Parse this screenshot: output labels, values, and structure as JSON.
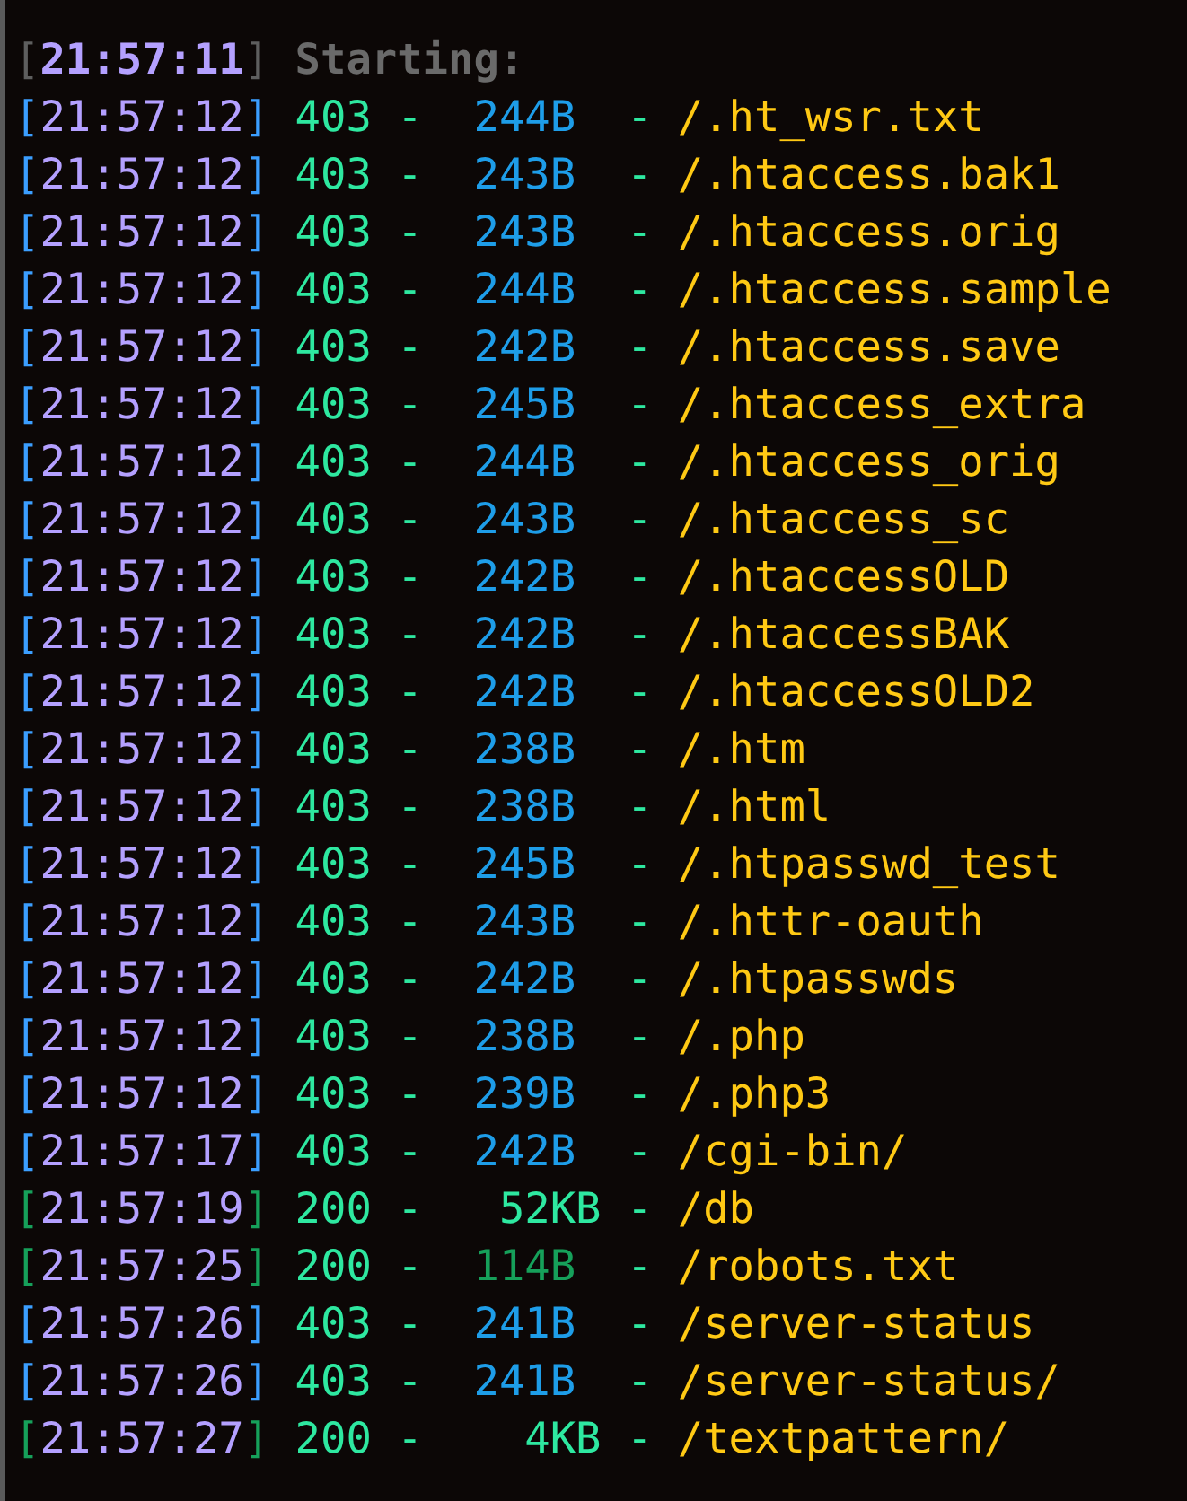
{
  "header": {
    "open": "[",
    "time": "21:57:11",
    "close": "]",
    "message": "Starting:"
  },
  "lines": [
    {
      "kind": "blocked",
      "open": "[",
      "time": "21:57:12",
      "close": "]",
      "status": "403",
      "dash": "-",
      "size": {
        "text": "244B",
        "kind": "bytes",
        "color": "#1e9de8"
      },
      "dash2": "-",
      "path": "/.ht_wsr.txt"
    },
    {
      "kind": "blocked",
      "open": "[",
      "time": "21:57:12",
      "close": "]",
      "status": "403",
      "dash": "-",
      "size": {
        "text": "243B",
        "kind": "bytes",
        "color": "#1e9de8"
      },
      "dash2": "-",
      "path": "/.htaccess.bak1"
    },
    {
      "kind": "blocked",
      "open": "[",
      "time": "21:57:12",
      "close": "]",
      "status": "403",
      "dash": "-",
      "size": {
        "text": "243B",
        "kind": "bytes",
        "color": "#1e9de8"
      },
      "dash2": "-",
      "path": "/.htaccess.orig"
    },
    {
      "kind": "blocked",
      "open": "[",
      "time": "21:57:12",
      "close": "]",
      "status": "403",
      "dash": "-",
      "size": {
        "text": "244B",
        "kind": "bytes",
        "color": "#1e9de8"
      },
      "dash2": "-",
      "path": "/.htaccess.sample"
    },
    {
      "kind": "blocked",
      "open": "[",
      "time": "21:57:12",
      "close": "]",
      "status": "403",
      "dash": "-",
      "size": {
        "text": "242B",
        "kind": "bytes",
        "color": "#1e9de8"
      },
      "dash2": "-",
      "path": "/.htaccess.save"
    },
    {
      "kind": "blocked",
      "open": "[",
      "time": "21:57:12",
      "close": "]",
      "status": "403",
      "dash": "-",
      "size": {
        "text": "245B",
        "kind": "bytes",
        "color": "#1e9de8"
      },
      "dash2": "-",
      "path": "/.htaccess_extra"
    },
    {
      "kind": "blocked",
      "open": "[",
      "time": "21:57:12",
      "close": "]",
      "status": "403",
      "dash": "-",
      "size": {
        "text": "244B",
        "kind": "bytes",
        "color": "#1e9de8"
      },
      "dash2": "-",
      "path": "/.htaccess_orig"
    },
    {
      "kind": "blocked",
      "open": "[",
      "time": "21:57:12",
      "close": "]",
      "status": "403",
      "dash": "-",
      "size": {
        "text": "243B",
        "kind": "bytes",
        "color": "#1e9de8"
      },
      "dash2": "-",
      "path": "/.htaccess_sc"
    },
    {
      "kind": "blocked",
      "open": "[",
      "time": "21:57:12",
      "close": "]",
      "status": "403",
      "dash": "-",
      "size": {
        "text": "242B",
        "kind": "bytes",
        "color": "#1e9de8"
      },
      "dash2": "-",
      "path": "/.htaccessOLD"
    },
    {
      "kind": "blocked",
      "open": "[",
      "time": "21:57:12",
      "close": "]",
      "status": "403",
      "dash": "-",
      "size": {
        "text": "242B",
        "kind": "bytes",
        "color": "#1e9de8"
      },
      "dash2": "-",
      "path": "/.htaccessBAK"
    },
    {
      "kind": "blocked",
      "open": "[",
      "time": "21:57:12",
      "close": "]",
      "status": "403",
      "dash": "-",
      "size": {
        "text": "242B",
        "kind": "bytes",
        "color": "#1e9de8"
      },
      "dash2": "-",
      "path": "/.htaccessOLD2"
    },
    {
      "kind": "blocked",
      "open": "[",
      "time": "21:57:12",
      "close": "]",
      "status": "403",
      "dash": "-",
      "size": {
        "text": "238B",
        "kind": "bytes",
        "color": "#1e9de8"
      },
      "dash2": "-",
      "path": "/.htm"
    },
    {
      "kind": "blocked",
      "open": "[",
      "time": "21:57:12",
      "close": "]",
      "status": "403",
      "dash": "-",
      "size": {
        "text": "238B",
        "kind": "bytes",
        "color": "#1e9de8"
      },
      "dash2": "-",
      "path": "/.html"
    },
    {
      "kind": "blocked",
      "open": "[",
      "time": "21:57:12",
      "close": "]",
      "status": "403",
      "dash": "-",
      "size": {
        "text": "245B",
        "kind": "bytes",
        "color": "#1e9de8"
      },
      "dash2": "-",
      "path": "/.htpasswd_test"
    },
    {
      "kind": "blocked",
      "open": "[",
      "time": "21:57:12",
      "close": "]",
      "status": "403",
      "dash": "-",
      "size": {
        "text": "243B",
        "kind": "bytes",
        "color": "#1e9de8"
      },
      "dash2": "-",
      "path": "/.httr-oauth"
    },
    {
      "kind": "blocked",
      "open": "[",
      "time": "21:57:12",
      "close": "]",
      "status": "403",
      "dash": "-",
      "size": {
        "text": "242B",
        "kind": "bytes",
        "color": "#1e9de8"
      },
      "dash2": "-",
      "path": "/.htpasswds"
    },
    {
      "kind": "blocked",
      "open": "[",
      "time": "21:57:12",
      "close": "]",
      "status": "403",
      "dash": "-",
      "size": {
        "text": "238B",
        "kind": "bytes",
        "color": "#1e9de8"
      },
      "dash2": "-",
      "path": "/.php"
    },
    {
      "kind": "blocked",
      "open": "[",
      "time": "21:57:12",
      "close": "]",
      "status": "403",
      "dash": "-",
      "size": {
        "text": "239B",
        "kind": "bytes",
        "color": "#1e9de8"
      },
      "dash2": "-",
      "path": "/.php3"
    },
    {
      "kind": "blocked",
      "open": "[",
      "time": "21:57:17",
      "close": "]",
      "status": "403",
      "dash": "-",
      "size": {
        "text": "242B",
        "kind": "bytes",
        "color": "#1e9de8"
      },
      "dash2": "-",
      "path": "/cgi-bin/"
    },
    {
      "kind": "found",
      "open": "[",
      "time": "21:57:19",
      "close": "]",
      "status": "200",
      "dash": "-",
      "size": {
        "text": "52KB",
        "kind": "kilobytes",
        "color": "#2ee8a0"
      },
      "dash2": "-",
      "path": "/db"
    },
    {
      "kind": "found",
      "open": "[",
      "time": "21:57:25",
      "close": "]",
      "status": "200",
      "dash": "-",
      "size": {
        "text": "114B",
        "kind": "bytes",
        "color": "#16a05a"
      },
      "dash2": "-",
      "path": "/robots.txt"
    },
    {
      "kind": "blocked",
      "open": "[",
      "time": "21:57:26",
      "close": "]",
      "status": "403",
      "dash": "-",
      "size": {
        "text": "241B",
        "kind": "bytes",
        "color": "#1e9de8"
      },
      "dash2": "-",
      "path": "/server-status"
    },
    {
      "kind": "blocked",
      "open": "[",
      "time": "21:57:26",
      "close": "]",
      "status": "403",
      "dash": "-",
      "size": {
        "text": "241B",
        "kind": "bytes",
        "color": "#1e9de8"
      },
      "dash2": "-",
      "path": "/server-status/"
    },
    {
      "kind": "found",
      "open": "[",
      "time": "21:57:27",
      "close": "]",
      "status": "200",
      "dash": "-",
      "size": {
        "text": "4KB",
        "kind": "kilobytes",
        "color": "#2ee8a0"
      },
      "dash2": "-",
      "path": "/textpattern/"
    }
  ]
}
